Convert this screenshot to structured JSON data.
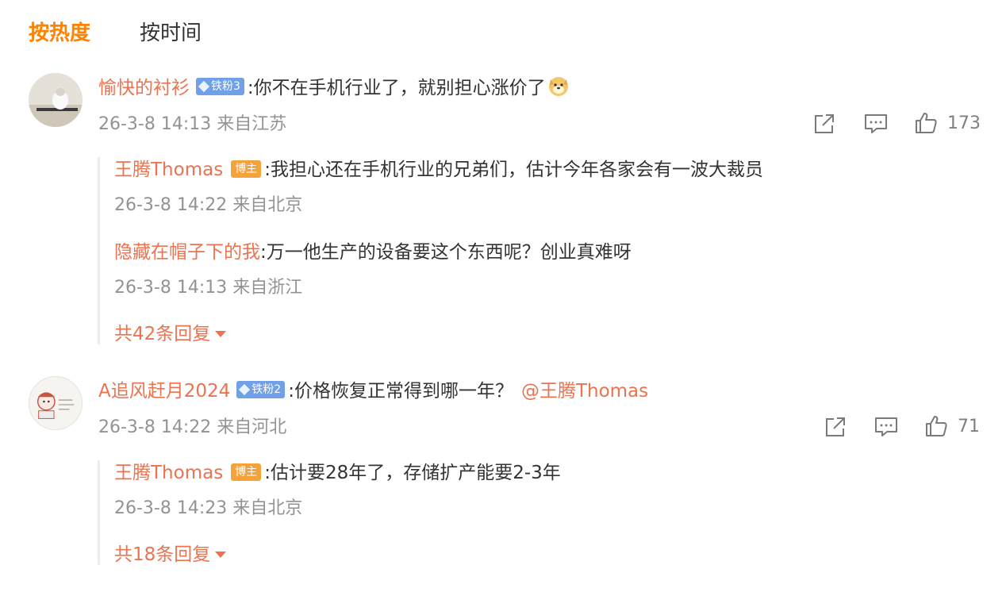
{
  "sort_tabs": {
    "hot": "按热度",
    "time": "按时间"
  },
  "colon": ":",
  "comments": [
    {
      "username": "愉快的衬衫",
      "badge": "铁粉3",
      "text": "你不在手机行业了，就别担心涨价了",
      "emoji_icon": "doge-emoji-icon",
      "meta": "26-3-8 14:13 来自江苏",
      "likes": "173",
      "replies": [
        {
          "username": "王腾Thomas",
          "badge": "博主",
          "text": "我担心还在手机行业的兄弟们，估计今年各家会有一波大裁员",
          "meta": "26-3-8 14:22 来自北京"
        },
        {
          "username": "隐藏在帽子下的我",
          "text": "万一他生产的设备要这个东西呢？创业真难呀",
          "meta": "26-3-8 14:13 来自浙江"
        }
      ],
      "more_replies": "共42条回复"
    },
    {
      "username": "A追风赶月2024",
      "badge": "铁粉2",
      "text": "价格恢复正常得到哪一年？",
      "mention": "@王腾Thomas",
      "meta": "26-3-8 14:22 来自河北",
      "likes": "71",
      "replies": [
        {
          "username": "王腾Thomas",
          "badge": "博主",
          "text": "估计要28年了，存储扩产能要2-3年",
          "meta": "26-3-8 14:23 来自北京"
        }
      ],
      "more_replies": "共18条回复"
    }
  ],
  "icons": {
    "share": "share-icon",
    "comment": "comment-icon",
    "like": "thumbs-up-icon",
    "expand": "caret-down-icon"
  },
  "colors": {
    "accent": "#ff8200",
    "username": "#eb7350",
    "meta": "#939393",
    "fan_badge": "#6fa0e8",
    "host_badge": "#f4a23a"
  }
}
